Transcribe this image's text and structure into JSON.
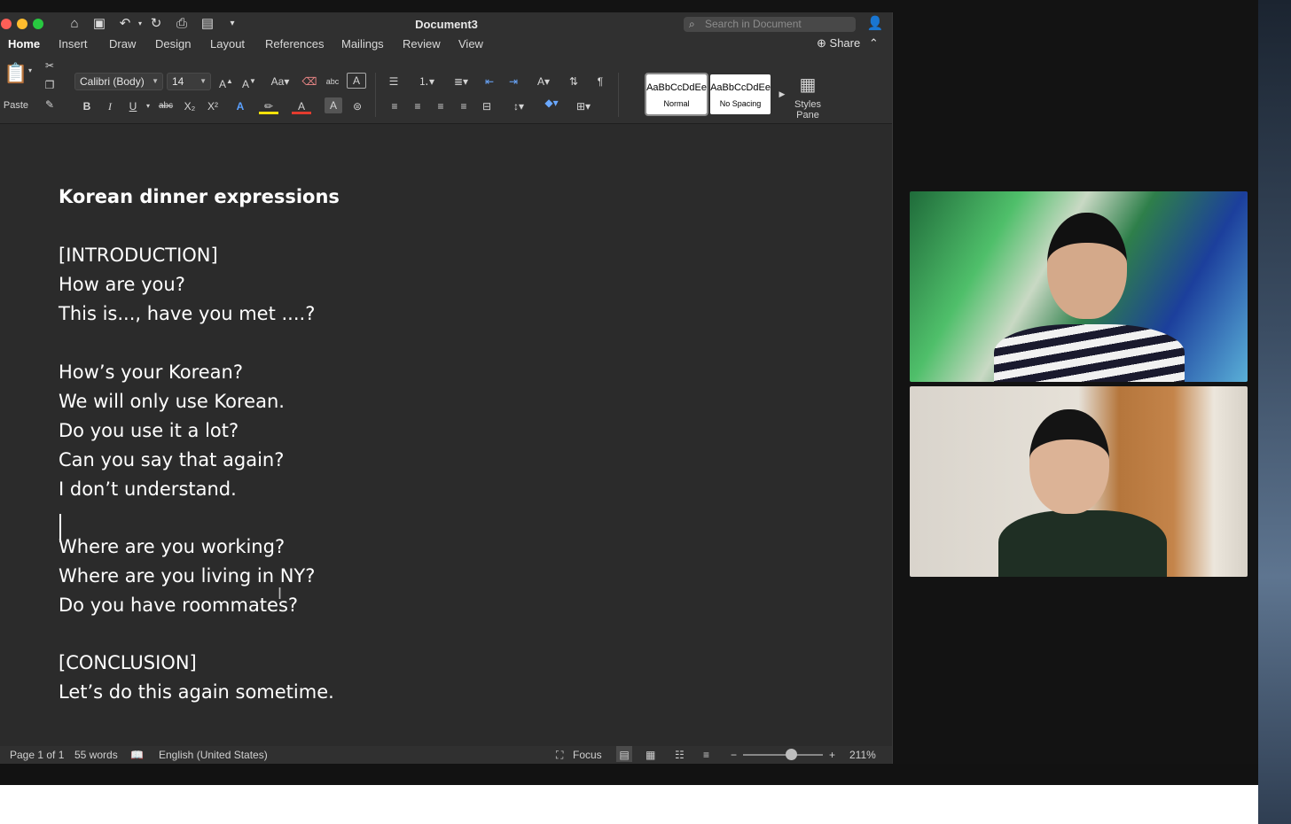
{
  "window": {
    "title": "Document3",
    "search_placeholder": "Search in Document",
    "share_label": "Share"
  },
  "tabs": [
    "Home",
    "Insert",
    "Draw",
    "Design",
    "Layout",
    "References",
    "Mailings",
    "Review",
    "View"
  ],
  "ribbon": {
    "paste_label": "Paste",
    "font_name": "Calibri (Body)",
    "font_size": "14",
    "styles": [
      {
        "preview": "AaBbCcDdEe",
        "name": "Normal"
      },
      {
        "preview": "AaBbCcDdEe",
        "name": "No Spacing"
      }
    ],
    "styles_pane_label_1": "Styles",
    "styles_pane_label_2": "Pane",
    "bold": "B",
    "italic": "I",
    "underline": "U",
    "strike": "abc",
    "sub": "X₂",
    "sup": "X²"
  },
  "document": {
    "title": "Korean dinner expressions",
    "lines": [
      "[INTRODUCTION]",
      "How are you?",
      "This is..., have you met ....?",
      "How’s your Korean?",
      "We will only use Korean.",
      "Do you use it a lot?",
      "Can you say that again?",
      "I don’t understand.",
      "Where are you working?",
      "Where are you living in NY?",
      "Do you have roommates?",
      "[CONCLUSION]",
      "Let’s do this again sometime."
    ]
  },
  "status": {
    "page": "Page 1 of 1",
    "words": "55 words",
    "language": "English (United States)",
    "focus": "Focus",
    "zoom": "211%",
    "zoom_fraction": 0.6
  },
  "colors": {
    "window_bg": "#2b2b2b",
    "chrome_bg": "#303030",
    "close": "#fe5f57",
    "minimize": "#febc2e",
    "maximize": "#28c840",
    "text": "#ffffff"
  }
}
